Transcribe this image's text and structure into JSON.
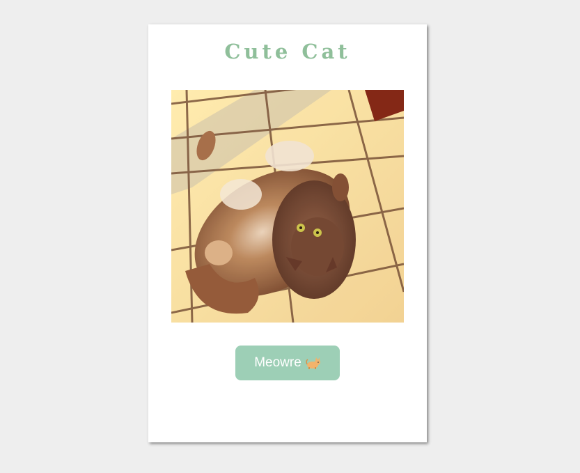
{
  "card": {
    "title": "Cute Cat"
  },
  "photo": {
    "icon": "cat-photo"
  },
  "button": {
    "label": "Meowre",
    "icon": "cat-emoji-icon"
  },
  "colors": {
    "background": "#eeeeee",
    "card": "#ffffff",
    "title": "#8fbf9a",
    "button": "#9dcfb6",
    "button_text": "#ffffff"
  }
}
